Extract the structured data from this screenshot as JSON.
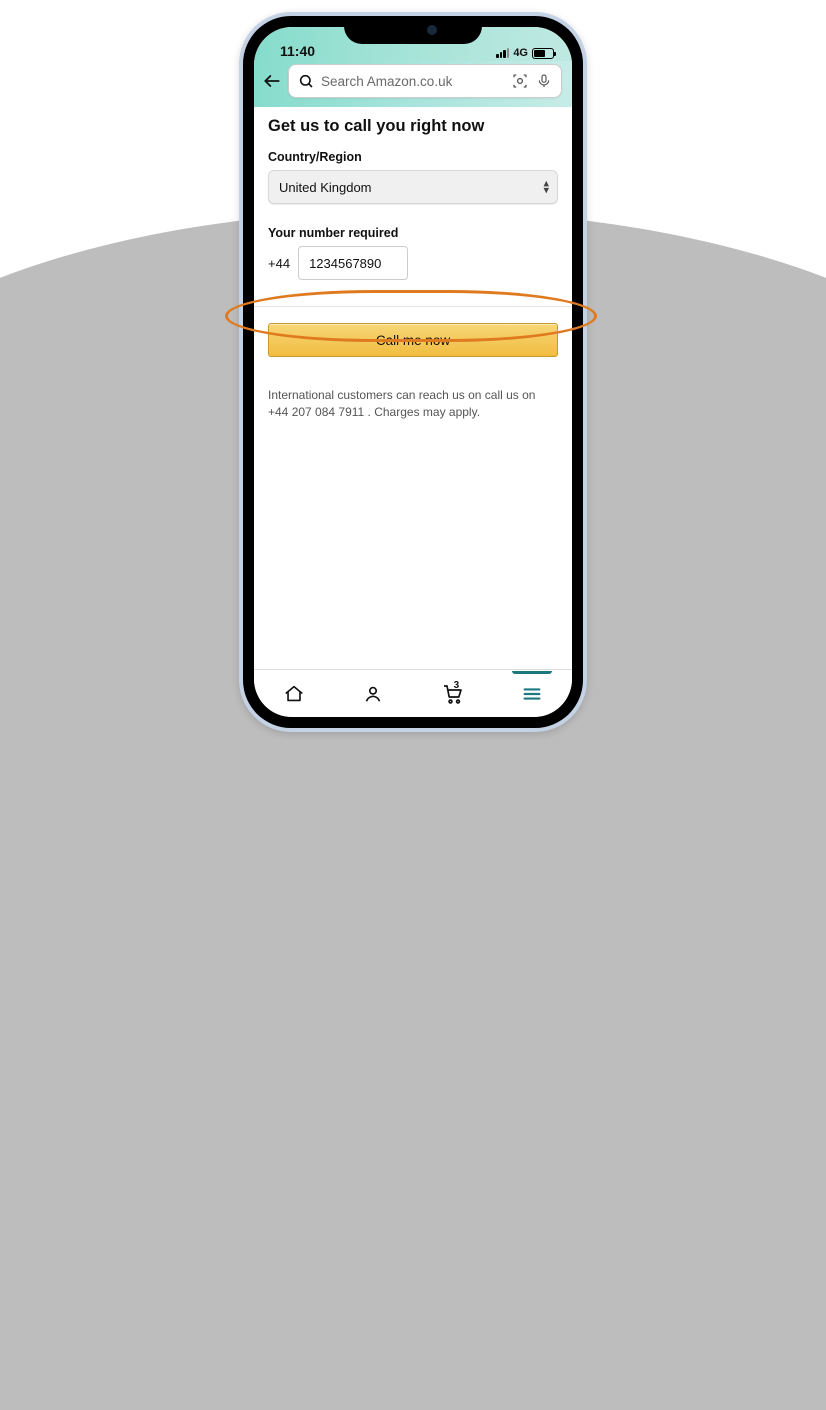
{
  "status": {
    "time": "11:40",
    "network": "4G"
  },
  "header": {
    "search_placeholder": "Search Amazon.co.uk"
  },
  "page": {
    "title": "Get us to call you right now",
    "country_label": "Country/Region",
    "country_selected": "United Kingdom",
    "number_label": "Your number required",
    "country_code": "+44",
    "number_value": "1234567890",
    "cta_label": "Call me now",
    "note": "International customers can reach us on call us on +44 207 084 7911 . Charges may apply."
  },
  "bottom_nav": {
    "cart_count": "3",
    "active_index": 3
  },
  "annotation": {
    "highlight": "call-me-now-button"
  }
}
